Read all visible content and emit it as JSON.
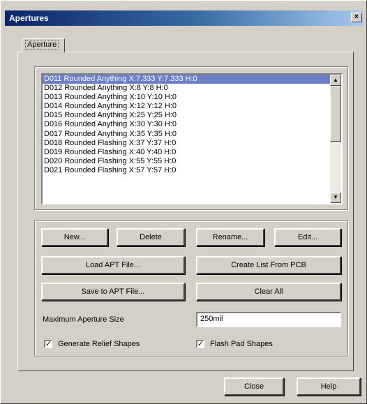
{
  "window": {
    "title": "Apertures",
    "close_glyph": "×"
  },
  "tabs": [
    {
      "label": "Aperture"
    }
  ],
  "apertures": [
    "D011 Rounded Anything X:7.333 Y:7.333 H:0",
    "D012 Rounded Anything X:8 Y:8 H:0",
    "D013 Rounded Anything X:10 Y:10 H:0",
    "D014 Rounded Anything X:12 Y:12 H:0",
    "D015 Rounded Anything X:25 Y:25 H:0",
    "D016 Rounded Anything X:30 Y:30 H:0",
    "D017 Rounded Anything X:35 Y:35 H:0",
    "D018 Rounded Flashing X:37 Y:37 H:0",
    "D019 Rounded Flashing X:40 Y:40 H:0",
    "D020 Rounded Flashing X:55 Y:55 H:0",
    "D021 Rounded Flashing X:57 Y:57 H:0"
  ],
  "selected_index": 0,
  "buttons": {
    "new": "New...",
    "delete": "Delete",
    "rename": "Rename...",
    "edit": "Edit...",
    "load": "Load APT File...",
    "create": "Create List From PCB",
    "save": "Save to APT File...",
    "clear": "Clear All",
    "close": "Close",
    "help": "Help"
  },
  "max_size": {
    "label": "Maximum Aperture Size",
    "value": "250mil"
  },
  "checkboxes": {
    "relief": {
      "label": "Generate Relief Shapes",
      "checked": true
    },
    "flash": {
      "label": "Flash Pad Shapes",
      "checked": true
    }
  },
  "check_glyph": "✓",
  "icons": {
    "scroll_up": "▲",
    "scroll_down": "▼"
  }
}
